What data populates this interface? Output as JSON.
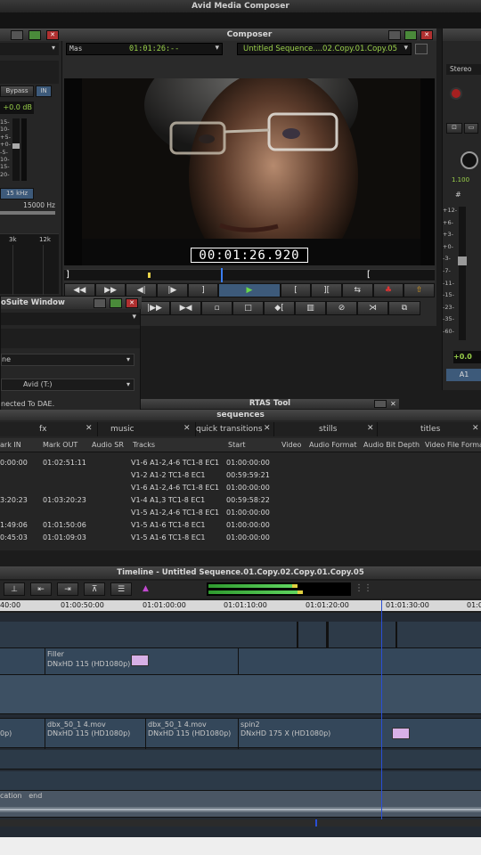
{
  "app": {
    "title": "Avid Media Composer"
  },
  "composer": {
    "title": "Composer",
    "left_source": "Mas",
    "left_timecode": "01:01:26:--",
    "sequence_name": "Untitled Sequence....02.Copy.01.Copy.05",
    "timecode_overlay": "00:01:26.920"
  },
  "audio_panel": {
    "bypass": "Bypass",
    "in": "IN",
    "gain": "+0.0 dB",
    "scale": [
      "15-",
      "10-",
      "+5-",
      "+0-",
      "-5-",
      "10-",
      "15-",
      "20-"
    ],
    "freq_btn": "15 kHz",
    "freq_val": "15000 Hz",
    "eq_labels": [
      "3k",
      "12k"
    ]
  },
  "right_panel": {
    "stereo": "Stereo",
    "knob_val": "1.100",
    "hash": "#",
    "scale": [
      "+12-",
      "+6-",
      "+3-",
      "+0-",
      "-3-",
      "-7-",
      "-11-",
      "-15-",
      "-23-",
      "-35-",
      "-60-"
    ],
    "fader_val": "+0.0",
    "track": "A1"
  },
  "prosuite": {
    "title": "oSuite Window",
    "field1": "ne",
    "drive": "Avid (T:)",
    "status": "nected To DAE."
  },
  "rtas": {
    "title": "RTAS Tool"
  },
  "bins": {
    "title": "sequences",
    "tabs": [
      "fx",
      "music",
      "quick transitions",
      "stills",
      "titles"
    ],
    "columns": [
      "ark IN",
      "Mark OUT",
      "Audio SR",
      "Tracks",
      "Start",
      "Video",
      "Audio Format",
      "Audio Bit Depth",
      "Video File Format"
    ],
    "rows": [
      {
        "in": "0:00:00",
        "out": "01:02:51:11",
        "tracks": "V1-6 A1-2,4-6 TC1-8 EC1",
        "start": "01:00:00:00"
      },
      {
        "in": "",
        "out": "",
        "tracks": "V1-2 A1-2 TC1-8 EC1",
        "start": "00:59:59:21"
      },
      {
        "in": "",
        "out": "",
        "tracks": "V1-6 A1-2,4-6 TC1-8 EC1",
        "start": "01:00:00:00"
      },
      {
        "in": "3:20:23",
        "out": "01:03:20:23",
        "tracks": "V1-4 A1,3 TC1-8 EC1",
        "start": "00:59:58:22"
      },
      {
        "in": "",
        "out": "",
        "tracks": "V1-5 A1-2,4-6 TC1-8 EC1",
        "start": "01:00:00:00"
      },
      {
        "in": "1:49:06",
        "out": "01:01:50:06",
        "tracks": "V1-5 A1-6 TC1-8 EC1",
        "start": "01:00:00:00"
      },
      {
        "in": "0:45:03",
        "out": "01:01:09:03",
        "tracks": "V1-5 A1-6 TC1-8 EC1",
        "start": "01:00:00:00"
      }
    ]
  },
  "timeline": {
    "title": "Timeline - Untitled Sequence.01.Copy.02.Copy.01.Copy.05",
    "ruler": [
      "40:00",
      "01:00:50:00",
      "01:01:00:00",
      "01:01:10:00",
      "01:01:20:00",
      "01:01:30:00",
      "01:0"
    ],
    "clips": {
      "filler_name": "Filler",
      "filler_fmt": "DNxHD 115 (HD1080p)",
      "c1_fmt": "0p)",
      "c2_name": "dbx_50_1 4.mov",
      "c2_fmt": "DNxHD 115 (HD1080p)",
      "c3_name": "dbx_50_1 4.mov",
      "c3_fmt": "DNxHD 115 (HD1080p)",
      "c4_name": "spin2",
      "c4_fmt": "DNxHD 175 X (HD1080p)",
      "a_label": "cation   end"
    }
  },
  "colors": {
    "accent_green": "#9ad14a",
    "playhead_blue": "#2a4fd6",
    "panel": "#2b2b2b",
    "clip": "#46607a"
  }
}
